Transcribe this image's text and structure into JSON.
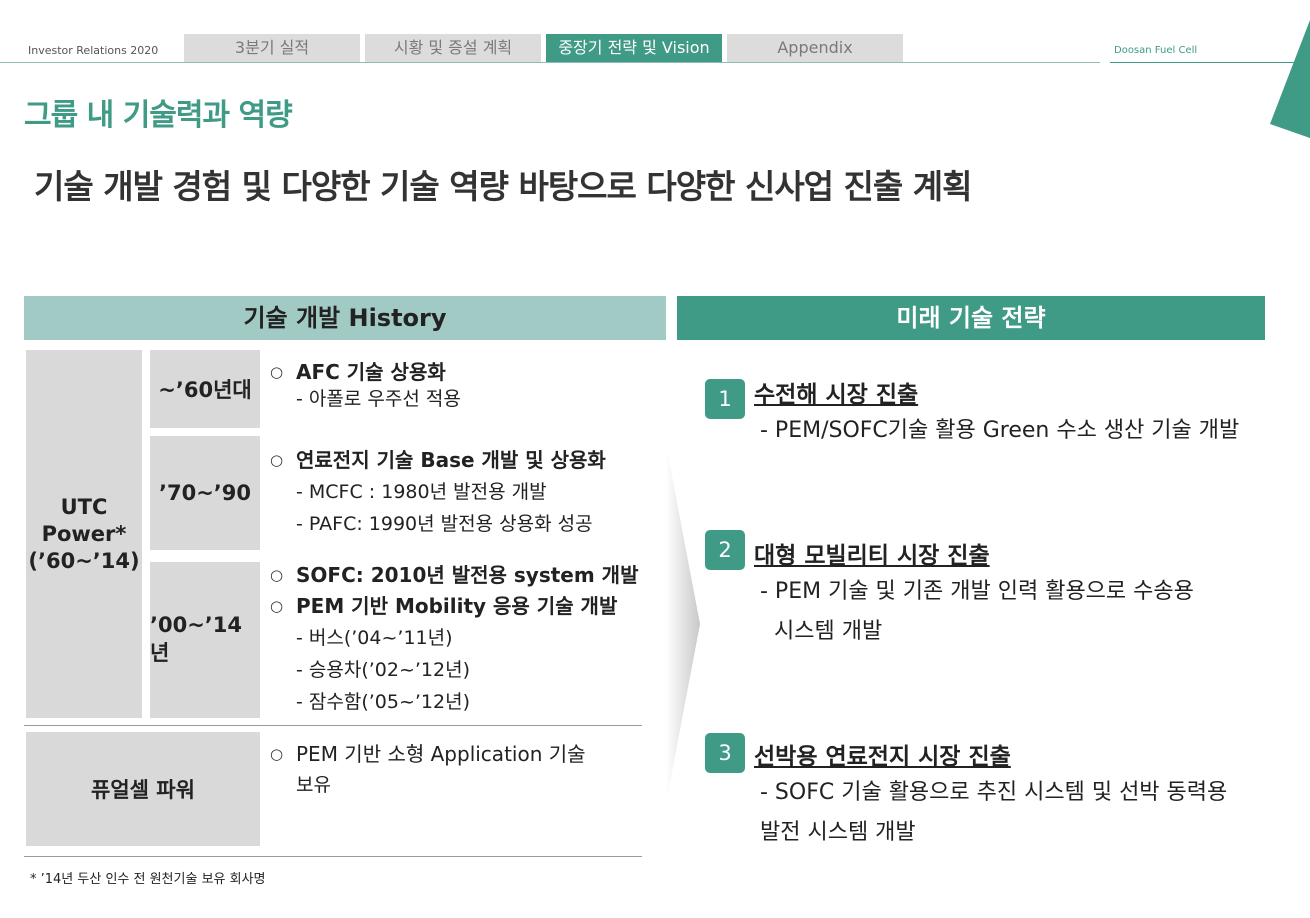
{
  "header": {
    "ir_label": "Investor Relations 2020",
    "tabs": [
      {
        "label": "3분기 실적",
        "active": false
      },
      {
        "label": "시황 및 증설 계획",
        "active": false
      },
      {
        "label": "중장기 전략 및 Vision",
        "active": true
      },
      {
        "label": "Appendix",
        "active": false
      }
    ],
    "brand": "Doosan Fuel Cell"
  },
  "page_title": "그룹 내 기술력과 역량",
  "headline": "기술 개발 경험 및 다양한 기술 역량 바탕으로 다양한 신사업 진출 계획",
  "history": {
    "header": "기술 개발 History",
    "company": [
      "UTC",
      "Power*",
      "(’60~’14)"
    ],
    "periods": [
      {
        "label": "~’60년대",
        "items": [
          "AFC 기술 상용화"
        ],
        "subs": [
          "- 아폴로 우주선 적용"
        ]
      },
      {
        "label": "’70~’90",
        "items": [
          "연료전지 기술 Base 개발 및 상용화"
        ],
        "subs": [
          "- MCFC : 1980년 발전용 개발",
          "- PAFC: 1990년 발전용 상용화 성공"
        ]
      },
      {
        "label": "’00~’14년",
        "items": [
          "SOFC: 2010년 발전용 system 개발",
          "PEM 기반 Mobility 응용 기술 개발"
        ],
        "subs": [
          "- 버스(’04~’11년)",
          "- 승용차(’02~’12년)",
          "- 잠수함(’05~’12년)"
        ]
      }
    ],
    "fuel_power": {
      "label": "퓨얼셀 파워",
      "item_lines": [
        "PEM 기반 소형 Application 기술",
        "보유"
      ]
    },
    "footnote": "* ’14년 두산 인수 전 원천기술 보유 회사명"
  },
  "strategy": {
    "header": "미래 기술 전략",
    "items": [
      {
        "num": "1",
        "title": "수전해 시장 진출",
        "desc": [
          "- PEM/SOFC기술 활용 Green 수소 생산 기술 개발"
        ]
      },
      {
        "num": "2",
        "title": "대형 모빌리티 시장 진출",
        "desc": [
          "- PEM 기술 및 기존 개발 인력 활용으로 수송용",
          "  시스템 개발"
        ]
      },
      {
        "num": "3",
        "title": "선박용 연료전지 시장 진출",
        "desc": [
          "- SOFC 기술 활용으로 추진 시스템 및 선박 동력용",
          "발전 시스템 개발"
        ]
      }
    ]
  },
  "colors": {
    "accent": "#3f9a86",
    "history_header": "#a2cac4",
    "panel_gray": "#d9d9d9"
  }
}
